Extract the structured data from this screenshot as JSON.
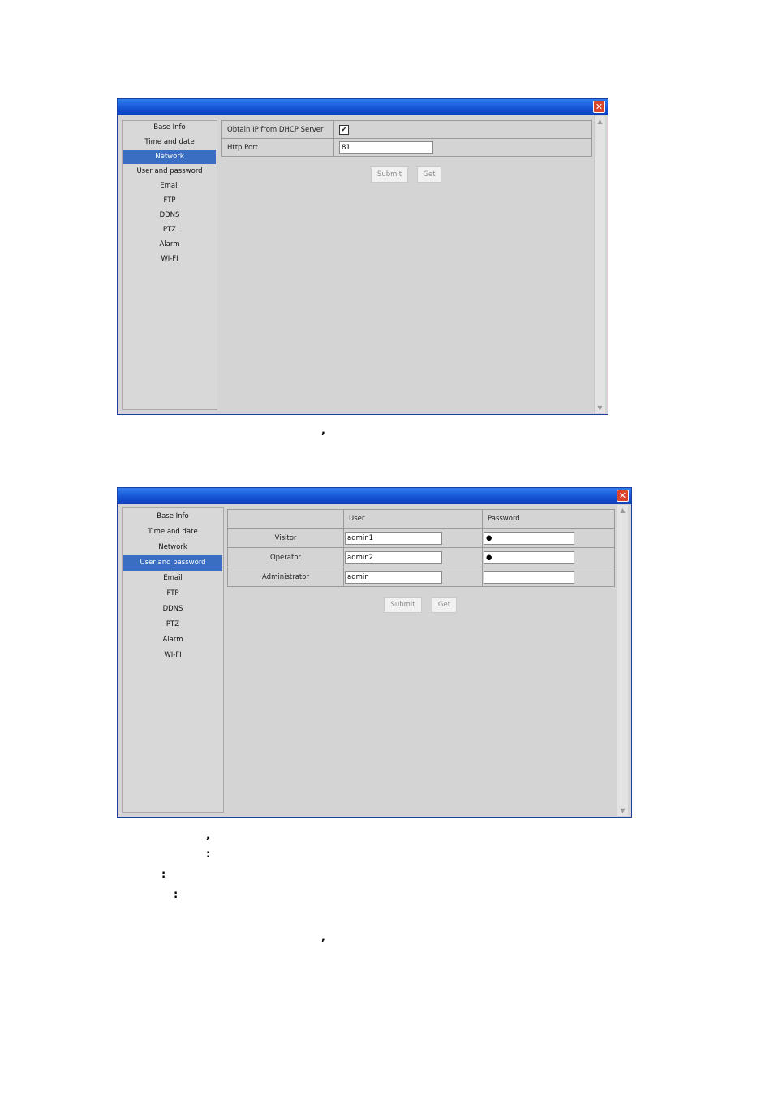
{
  "window1": {
    "close_glyph": "✕",
    "sidebar": [
      "Base Info",
      "Time and date",
      "Network",
      "User and password",
      "Email",
      "FTP",
      "DDNS",
      "PTZ",
      "Alarm",
      "WI-FI"
    ],
    "selected": "Network",
    "dhcp_label": "Obtain IP from DHCP Server",
    "dhcp_checked": "✔",
    "port_label": "Http Port",
    "port_value": "81",
    "submit": "Submit",
    "get": "Get"
  },
  "window2": {
    "close_glyph": "✕",
    "sidebar": [
      "Base Info",
      "Time and date",
      "Network",
      "User and password",
      "Email",
      "FTP",
      "DDNS",
      "PTZ",
      "Alarm",
      "WI-FI"
    ],
    "selected": "User and password",
    "col_user": "User",
    "col_password": "Password",
    "rows": [
      {
        "role": "Visitor",
        "user": "admin1",
        "password": "●"
      },
      {
        "role": "Operator",
        "user": "admin2",
        "password": "●"
      },
      {
        "role": "Administrator",
        "user": "admin",
        "password": ""
      }
    ],
    "submit": "Submit",
    "get": "Get"
  },
  "page_marks": [
    ",",
    ",",
    ":",
    ":",
    ":",
    ","
  ]
}
